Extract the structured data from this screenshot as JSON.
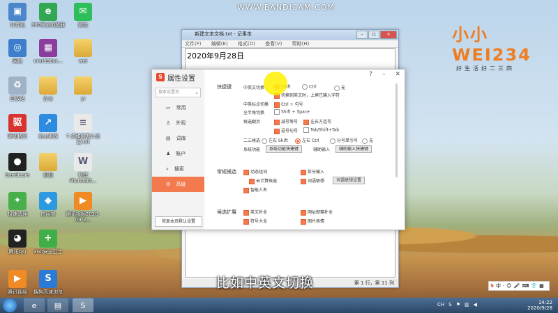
{
  "watermark": "WWW.BANDICAM.COM",
  "logo": {
    "text": "小小WEI234",
    "sub": "好生活好二三四"
  },
  "desktop_icons": [
    {
      "label": "计算机",
      "icon": "computer-icon"
    },
    {
      "label": "360安全浏览器",
      "icon": "browser-icon"
    },
    {
      "label": "微信",
      "icon": "wechat-icon"
    },
    {
      "label": "网络",
      "icon": "network-icon"
    },
    {
      "label": "vrar590sc...",
      "icon": "archive-icon"
    },
    {
      "label": "wei",
      "icon": "folder-icon"
    },
    {
      "label": "回收站",
      "icon": "recycle-bin-icon"
    },
    {
      "label": "办公",
      "icon": "folder-icon"
    },
    {
      "label": "yi",
      "icon": "folder-icon"
    },
    {
      "label": "驱动精灵",
      "icon": "driver-icon"
    },
    {
      "label": "金山毒霸",
      "icon": "antivirus-icon"
    },
    {
      "label": "7.该如何怎么设置.txt",
      "icon": "text-file-icon"
    },
    {
      "label": "bandicam",
      "icon": "record-icon"
    },
    {
      "label": "旧旧",
      "icon": "folder-icon"
    },
    {
      "label": "新建Microsoft...",
      "icon": "doc-icon"
    },
    {
      "label": "极速清理",
      "icon": "clean-icon"
    },
    {
      "label": "应用宝",
      "icon": "app-store-icon"
    },
    {
      "label": "腾讯视频2020-09-2...",
      "icon": "video-icon"
    },
    {
      "label": "腾讯QQ",
      "icon": "qq-icon"
    },
    {
      "label": "360安全卫士",
      "icon": "guard-icon"
    },
    {
      "label": "腾讯视频",
      "icon": "video-icon"
    },
    {
      "label": "搜狗高速浏览",
      "icon": "sogou-browser-icon"
    }
  ],
  "notepad": {
    "title": "新建文本文档.txt - 记事本",
    "menu": [
      "文件(F)",
      "编辑(E)",
      "格式(O)",
      "查看(V)",
      "帮助(H)"
    ],
    "text": "2020年9月28日",
    "status": "第 1 行，第 11 列"
  },
  "dialog": {
    "title": "属性设置",
    "help": "?",
    "search_placeholder": "搜索设置项",
    "nav": [
      "常用",
      "外观",
      "词库",
      "账户",
      "搜索",
      "高级"
    ],
    "active_nav": "高级",
    "reset": "恢复本页默认设置",
    "sections": {
      "hotkey": "快捷键",
      "common": "常规候选",
      "extend": "候选扩展"
    },
    "rows": {
      "cn_en_switch": "中英文切换",
      "opt_shift": "Shift",
      "opt_ctrl": "Ctrl",
      "opt_none": "无",
      "switch_hint": "切换到英文时，上屏已输入字符",
      "punct_switch": "中英标点切换",
      "punct_opt": "Ctrl + 句号",
      "width_switch": "全半角切换",
      "width_opt": "Shift + Space",
      "pageturn": "候选翻页",
      "minus_eq": "减号等号",
      "brackets": "左右方括号",
      "comma_period": "逗号句号",
      "tab": "Tab/Shift+Tab",
      "second_third": "二三候选",
      "left_right_shift": "左右 Shift",
      "left_right_ctrl": "左右 Ctrl",
      "quote": "分号单引号",
      "none2": "无",
      "sysfunc": "系统功能",
      "sysfunc_btn": "系统功能快捷键",
      "aux_input": "辅助输入",
      "aux_btn": "辅助输入快捷键",
      "dyn_combine": "动态组词",
      "split_input": "拆分输入",
      "cloud_calc": "云计算候选",
      "word_assoc": "词语联想",
      "word_assoc_btn": "词语联想设置",
      "smart_names": "智能人名",
      "en_complete": "英文补全",
      "email_complete": "网址邮箱补全",
      "symbols": "符号大全",
      "emoji": "图片表情"
    }
  },
  "subtitle": "比如中英文切换",
  "ime_bar": [
    "S",
    "中",
    "·",
    "☺",
    "🎤",
    "⌨",
    "👕",
    "▦"
  ],
  "taskbar": {
    "lang": "CH",
    "time": "14:22",
    "date": "2020/9/28"
  }
}
